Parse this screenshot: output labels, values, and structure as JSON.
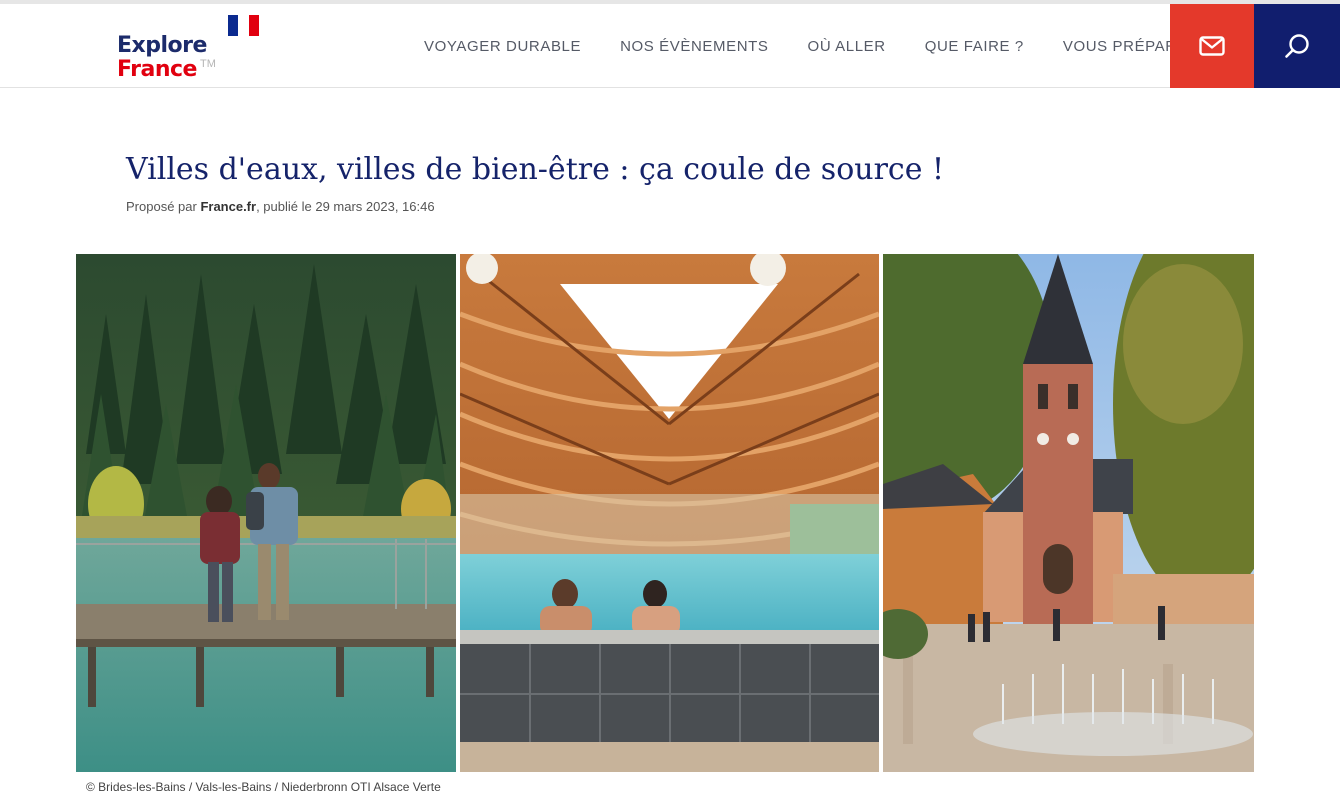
{
  "logo": {
    "line1": "Explore",
    "line2": "France",
    "tm": "TM"
  },
  "flag_colors": [
    "#0b2a8f",
    "#ffffff",
    "#e1000f"
  ],
  "nav": [
    {
      "label": "VOYAGER DURABLE"
    },
    {
      "label": "NOS ÉVÈNEMENTS"
    },
    {
      "label": "OÙ ALLER"
    },
    {
      "label": "QUE FAIRE ?"
    },
    {
      "label": "VOUS PRÉPARER"
    }
  ],
  "header_buttons": {
    "mail_icon": "mail-icon",
    "mail_color": "#e4392b",
    "search_icon": "search-icon",
    "search_color": "#111e6e"
  },
  "article": {
    "title": "Villes d'eaux, villes de bien-être : ça coule de source !",
    "meta_prefix": "Proposé par ",
    "author": "France.fr",
    "meta_suffix": ", publié le 29 mars 2023, 16:46"
  },
  "gallery": {
    "images": [
      {
        "subject": "lake-boardwalk-hikers"
      },
      {
        "subject": "thermal-spa-pool-wooden-roof"
      },
      {
        "subject": "church-square-fountains"
      }
    ],
    "credit": "© Brides-les-Bains / Vals-les-Bains / Niederbronn OTI Alsace Verte"
  }
}
